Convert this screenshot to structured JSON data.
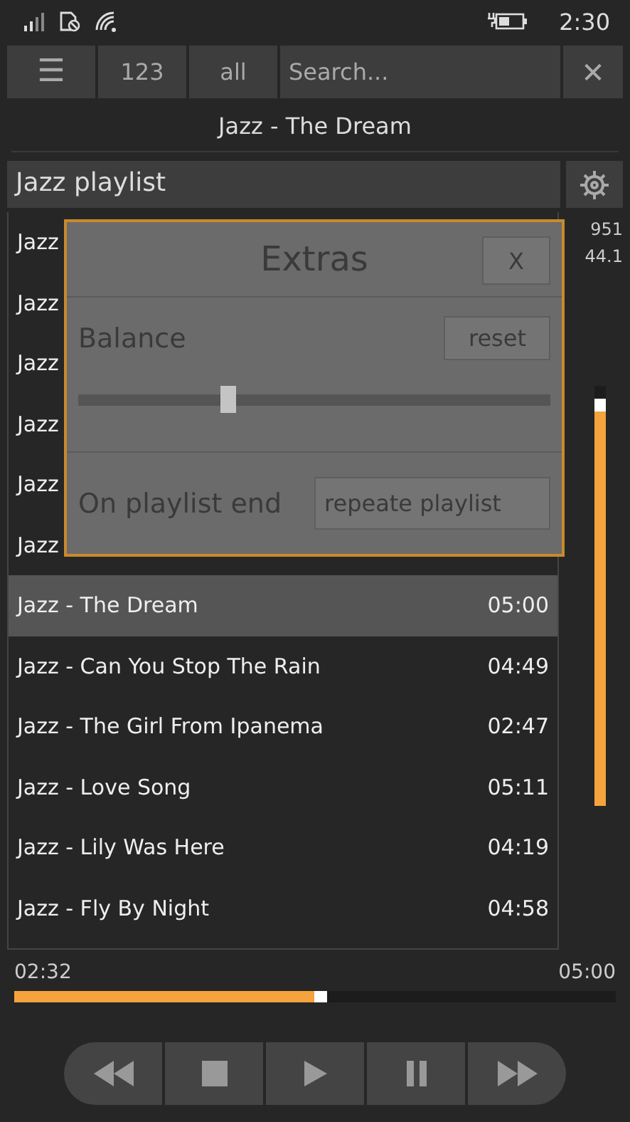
{
  "status_bar": {
    "time": "2:30"
  },
  "toolbar": {
    "menu": "☰",
    "numbers": "123",
    "filter": "all",
    "search": {
      "placeholder": "Search..."
    },
    "clear": "✕"
  },
  "now_playing": "Jazz - The Dream",
  "playlist": {
    "title": "Jazz playlist",
    "rows": [
      {
        "title": "Jazz",
        "selected": false
      },
      {
        "title": "Jazz",
        "selected": false
      },
      {
        "title": "Jazz",
        "selected": false
      },
      {
        "title": "Jazz",
        "selected": false
      },
      {
        "title": "Jazz",
        "selected": false
      },
      {
        "title": "Jazz",
        "selected": false
      },
      {
        "title": "Jazz - The Dream",
        "duration": "05:00",
        "selected": true
      },
      {
        "title": "Jazz - Can You Stop The Rain",
        "duration": "04:49",
        "selected": false
      },
      {
        "title": "Jazz - The Girl From Ipanema",
        "duration": "02:47",
        "selected": false
      },
      {
        "title": "Jazz - Love Song",
        "duration": "05:11",
        "selected": false
      },
      {
        "title": "Jazz - Lily Was Here",
        "duration": "04:19",
        "selected": false
      },
      {
        "title": "Jazz - Fly By Night",
        "duration": "04:58",
        "selected": false
      }
    ]
  },
  "info": {
    "bitrate": "951",
    "sample_rate": "44.1"
  },
  "volume": {
    "level": 0.97
  },
  "dialog": {
    "title": "Extras",
    "close": "X",
    "balance": {
      "label": "Balance",
      "reset": "reset",
      "level": 0.32
    },
    "end": {
      "label": "On playlist end",
      "value": "repeate playlist"
    }
  },
  "progress": {
    "elapsed": "02:32",
    "total": "05:00",
    "level": 0.52
  },
  "controls": [
    {
      "kind": "rewind"
    },
    {
      "kind": "stop"
    },
    {
      "kind": "play"
    },
    {
      "kind": "pause"
    },
    {
      "kind": "forward"
    }
  ]
}
